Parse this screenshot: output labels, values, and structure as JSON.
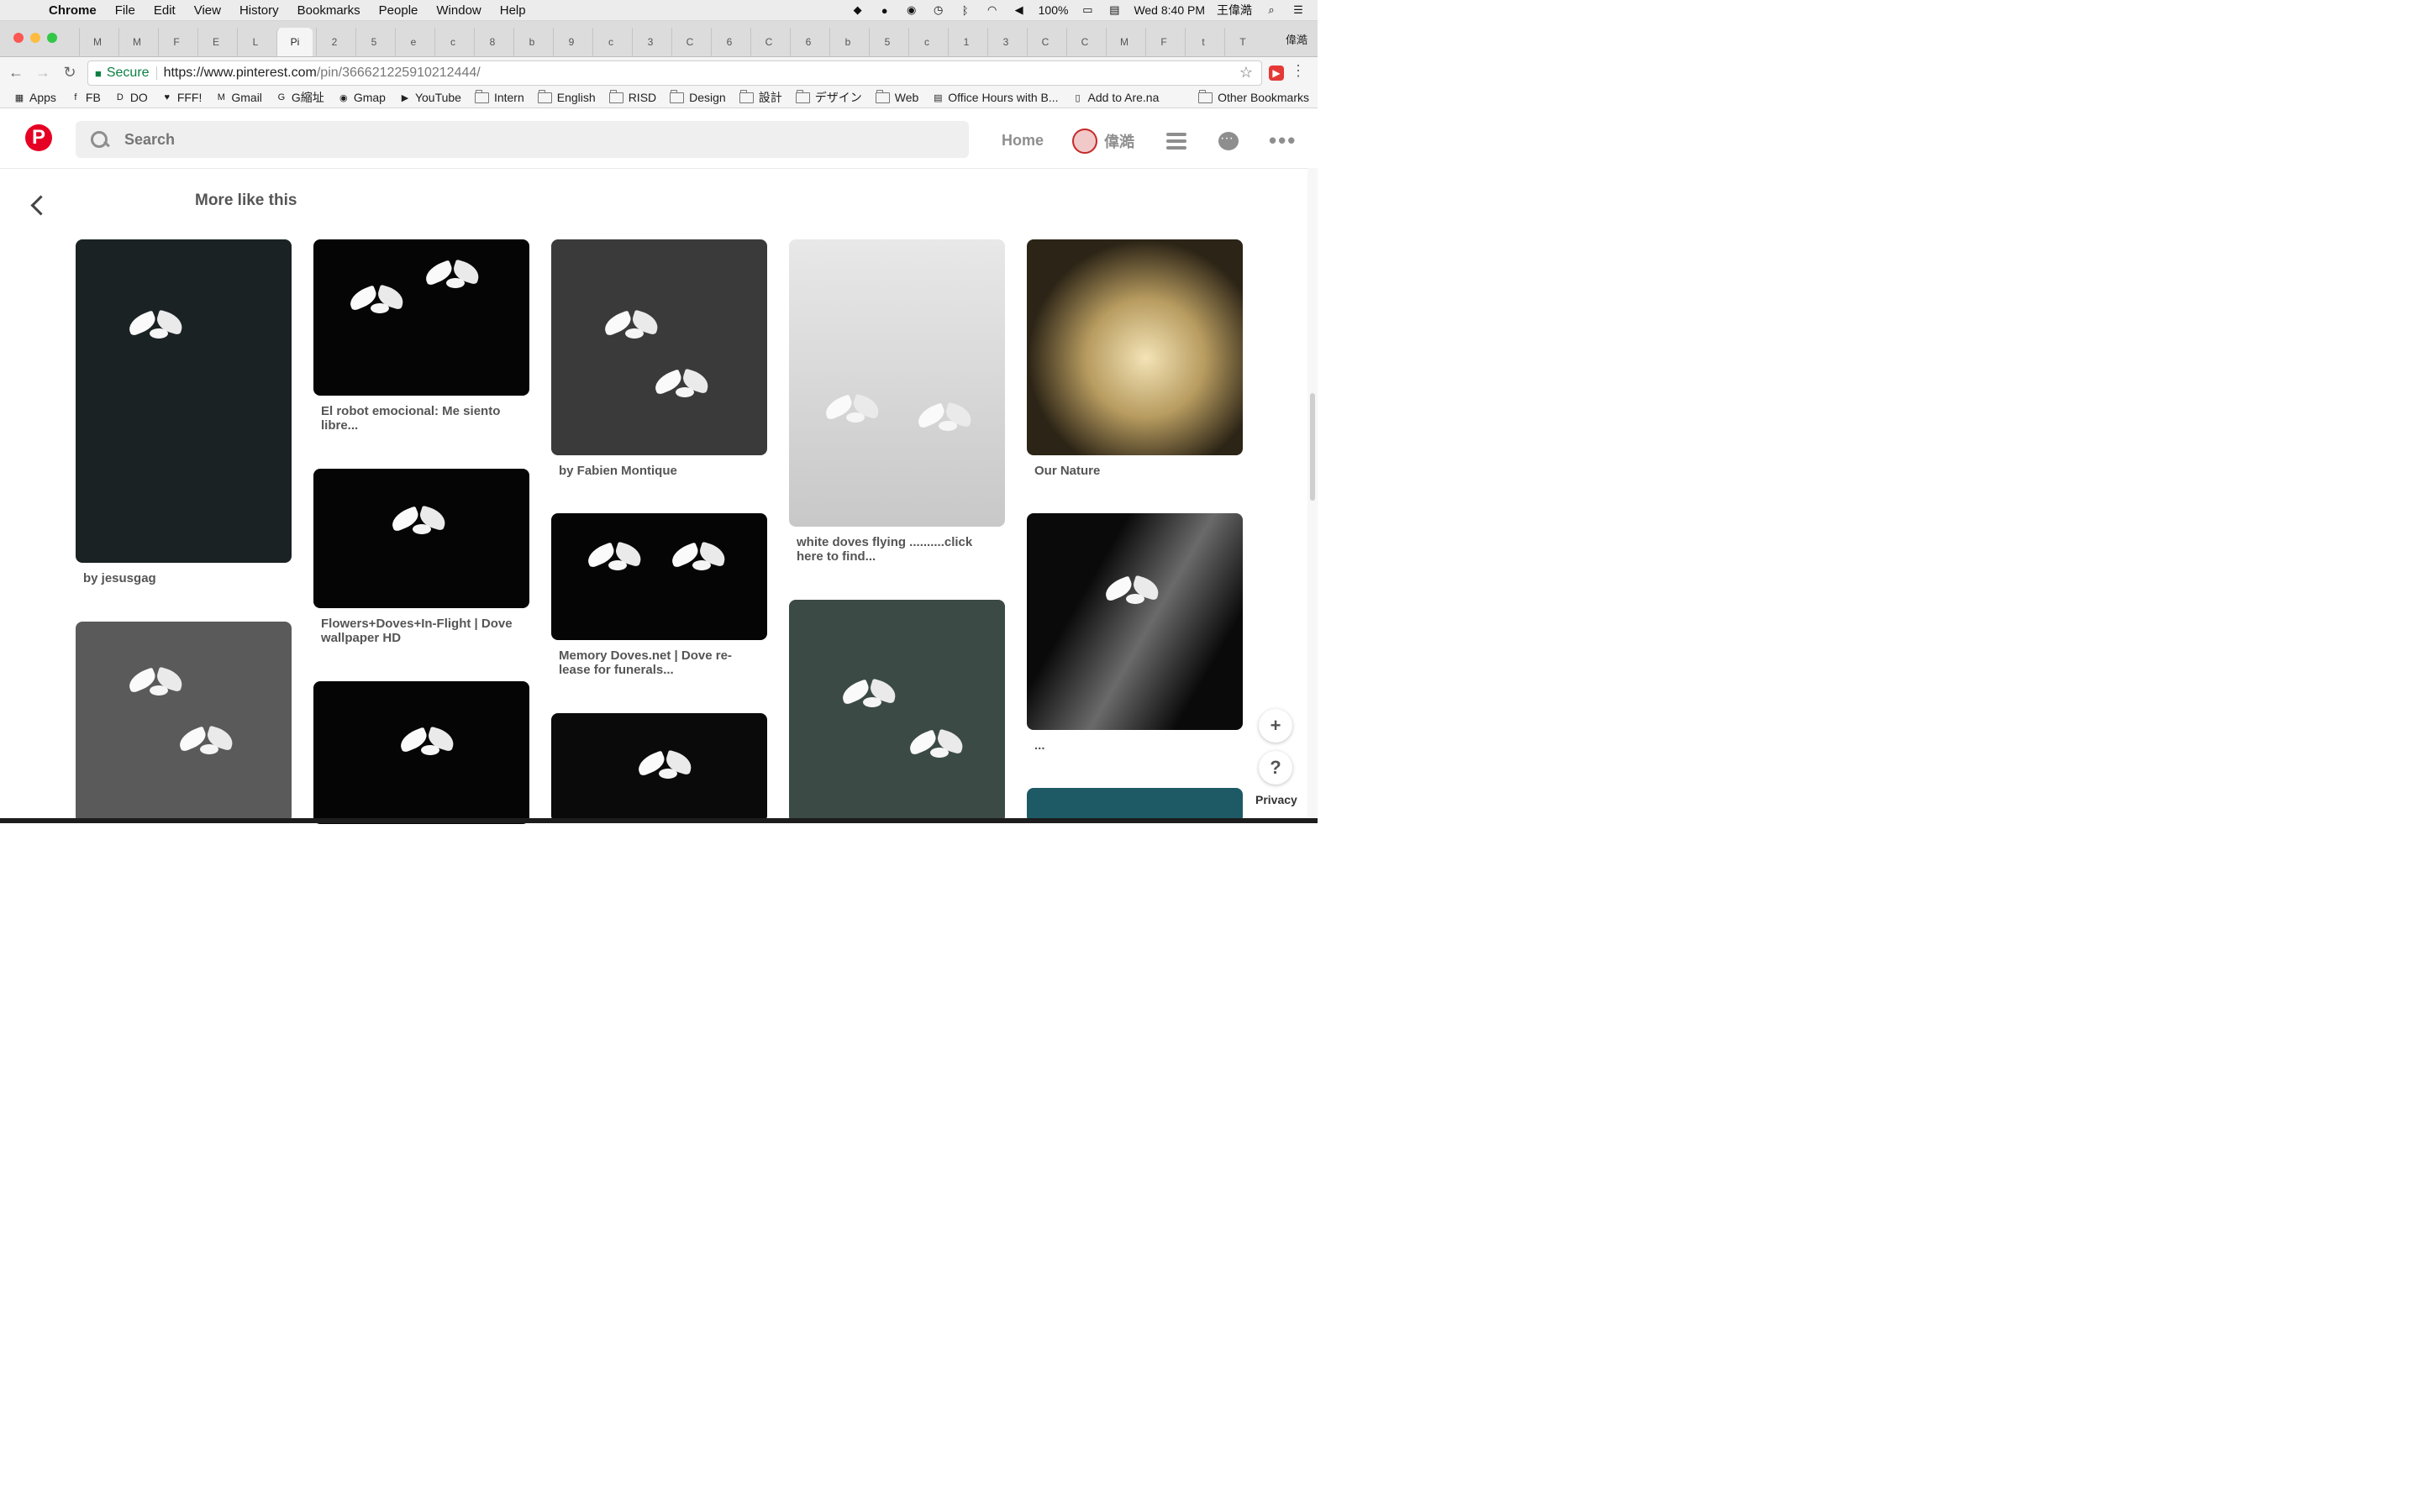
{
  "macos_menubar": {
    "app_name": "Chrome",
    "menus": [
      "File",
      "Edit",
      "View",
      "History",
      "Bookmarks",
      "People",
      "Window",
      "Help"
    ],
    "battery": "100%",
    "datetime": "Wed 8:40 PM",
    "user": "王偉澔"
  },
  "browser": {
    "tabs": [
      "M",
      "M",
      "F",
      "E",
      "L",
      "Pi",
      "2",
      "5",
      "e",
      "c",
      "8",
      "b",
      "9",
      "c",
      "3",
      "C",
      "6",
      "C",
      "6",
      "b",
      "5",
      "c",
      "1",
      "3",
      "C",
      "C",
      "M",
      "F",
      "t",
      "T"
    ],
    "active_tab_index": 5,
    "profile_name": "偉澔",
    "omnibox": {
      "secure_label": "Secure",
      "url_host": "https://www.pinterest.com",
      "url_path": "/pin/366621225910212444/"
    },
    "bookmarks": [
      {
        "label": "Apps",
        "icon": "apps-grid-icon"
      },
      {
        "label": "FB",
        "icon": "facebook-icon"
      },
      {
        "label": "DO",
        "icon": "do-icon"
      },
      {
        "label": "FFF!",
        "icon": "heart-icon"
      },
      {
        "label": "Gmail",
        "icon": "gmail-icon"
      },
      {
        "label": "G縮址",
        "icon": "google-icon"
      },
      {
        "label": "Gmap",
        "icon": "map-icon"
      },
      {
        "label": "YouTube",
        "icon": "youtube-icon"
      },
      {
        "label": "Intern",
        "icon": "folder-icon"
      },
      {
        "label": "English",
        "icon": "folder-icon"
      },
      {
        "label": "RISD",
        "icon": "folder-icon"
      },
      {
        "label": "Design",
        "icon": "folder-icon"
      },
      {
        "label": "設計",
        "icon": "folder-icon"
      },
      {
        "label": "デザイン",
        "icon": "folder-icon"
      },
      {
        "label": "Web",
        "icon": "folder-icon"
      },
      {
        "label": "Office Hours with B...",
        "icon": "docs-icon"
      },
      {
        "label": "Add to Are.na",
        "icon": "page-icon"
      }
    ],
    "other_bookmarks": "Other Bookmarks"
  },
  "pinterest": {
    "search_placeholder": "Search",
    "home_label": "Home",
    "user_name": "偉澔",
    "section_title": "More like this",
    "pins": [
      {
        "caption": "by jesusgag"
      },
      {
        "caption": ""
      },
      {
        "caption": "El robot emocional: Me siento libre..."
      },
      {
        "caption": "Flowers+Doves+In-Flight | Dove wallpaper HD"
      },
      {
        "caption": ""
      },
      {
        "caption": "by Fabien Montique"
      },
      {
        "caption": "Memory Doves.net | Dove re-lease for funerals..."
      },
      {
        "caption": ""
      },
      {
        "caption": "white doves flying ..........click here to find..."
      },
      {
        "caption": ""
      },
      {
        "caption": "Our Nature"
      },
      {
        "caption": "..."
      },
      {
        "caption": ""
      }
    ],
    "privacy_label": "Privacy"
  }
}
